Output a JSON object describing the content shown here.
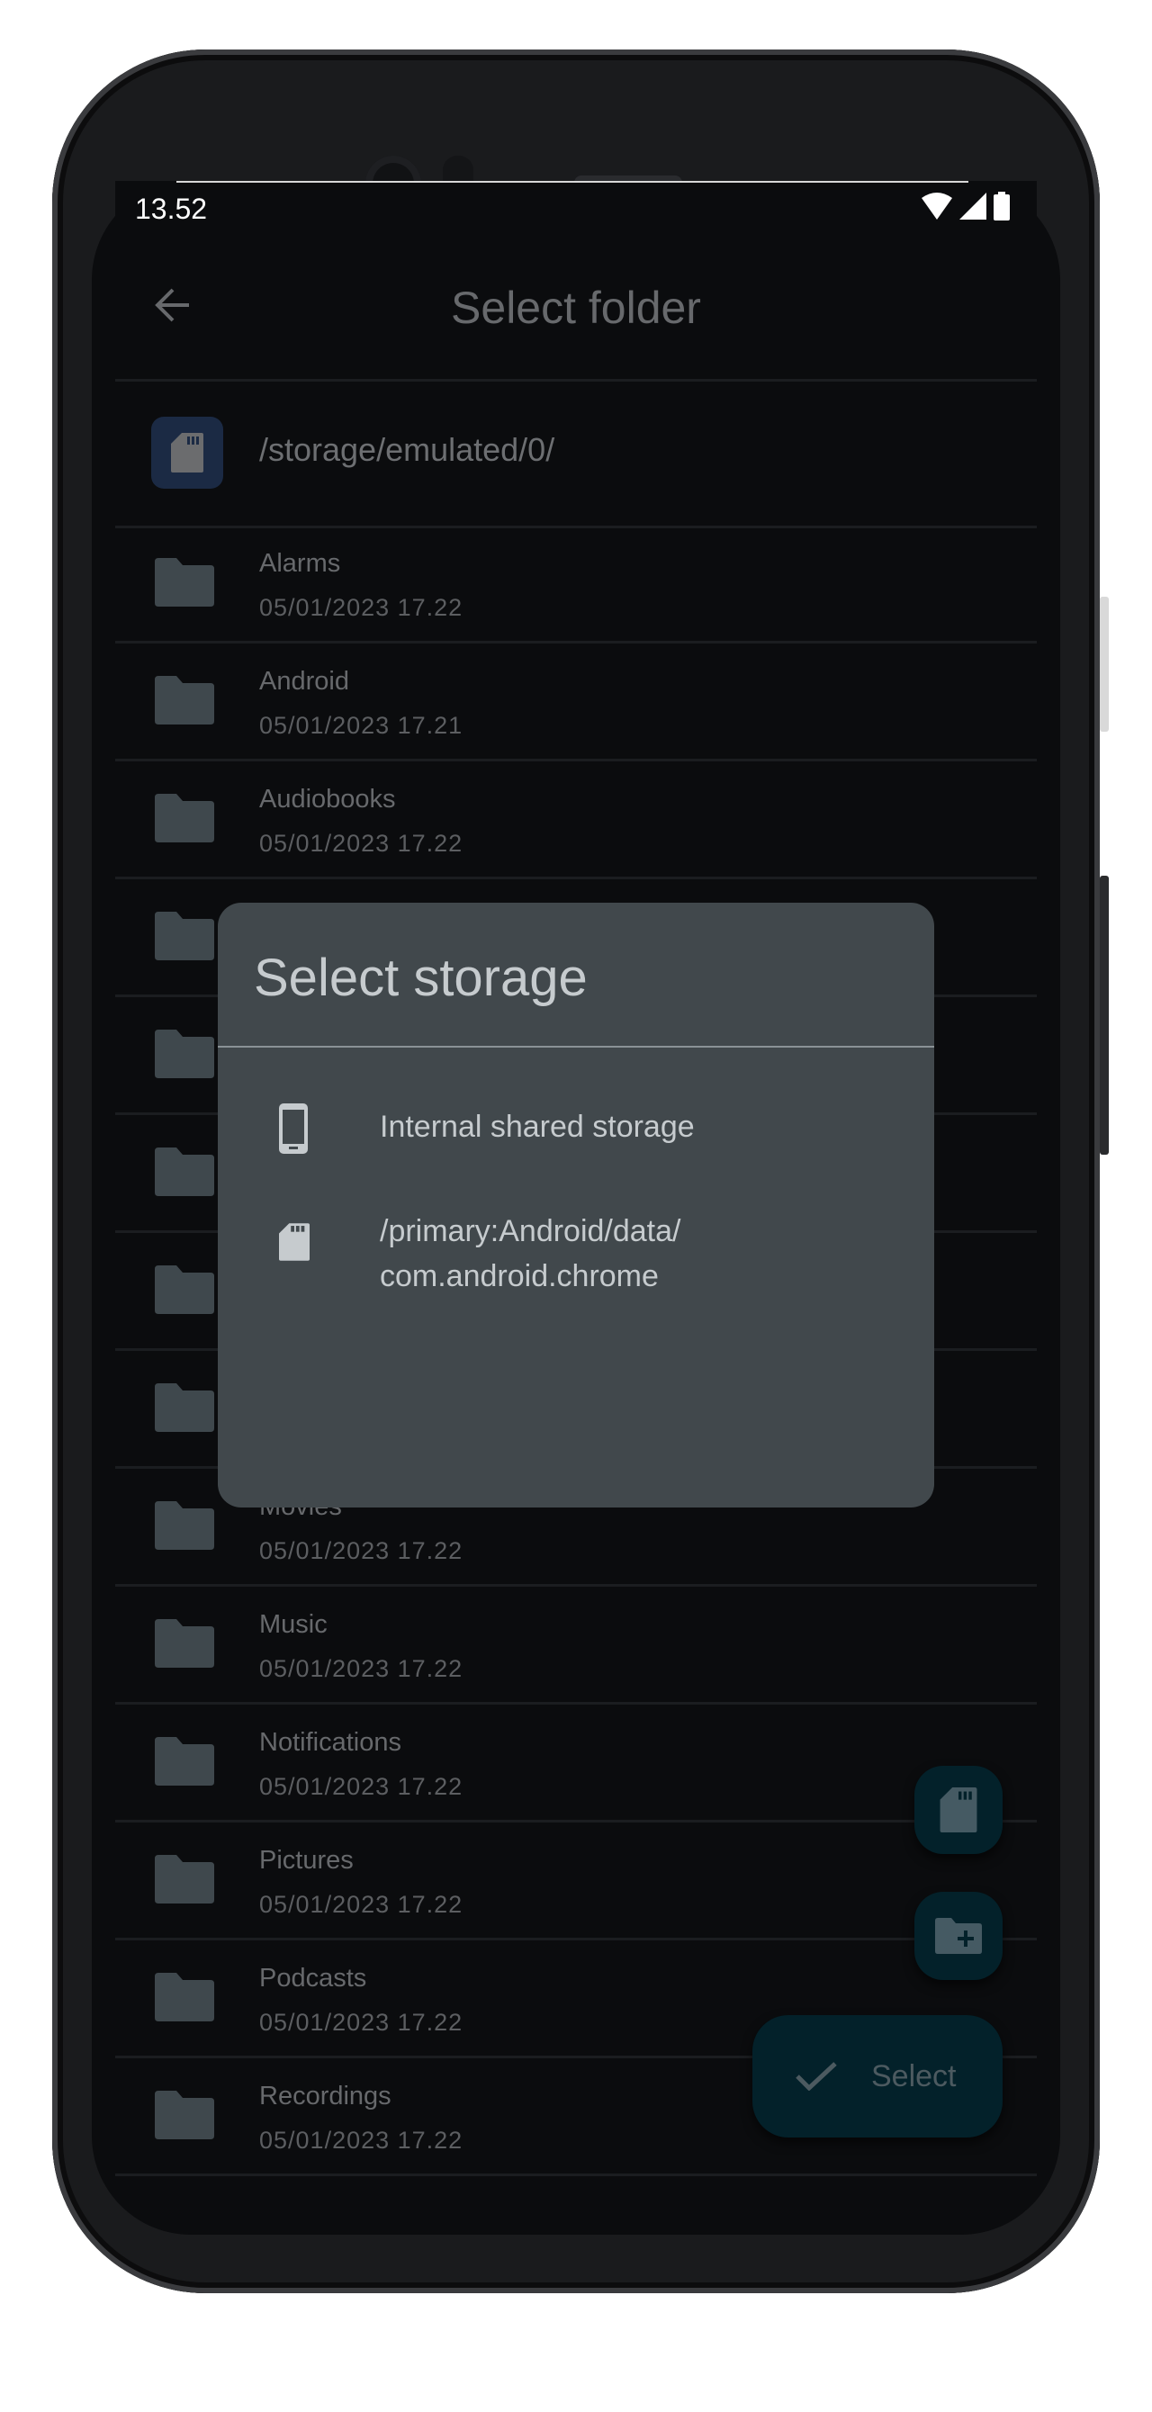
{
  "status_bar": {
    "time": "13.52",
    "icons": [
      "wifi-icon",
      "signal-icon",
      "battery-icon"
    ]
  },
  "app_bar": {
    "title": "Select folder",
    "back_icon": "arrow-back-icon"
  },
  "current_path": {
    "icon": "sd-card-icon",
    "path": "/storage/emulated/0/"
  },
  "folders": [
    {
      "name": "Alarms",
      "date": "05/01/2023 17.22"
    },
    {
      "name": "Android",
      "date": "05/01/2023 17.21"
    },
    {
      "name": "Audiobooks",
      "date": "05/01/2023 17.22"
    },
    {
      "name": "",
      "date": ""
    },
    {
      "name": "",
      "date": ""
    },
    {
      "name": "",
      "date": ""
    },
    {
      "name": "",
      "date": ""
    },
    {
      "name": "",
      "date": ""
    },
    {
      "name": "Movies",
      "date": "05/01/2023 17.22"
    },
    {
      "name": "Music",
      "date": "05/01/2023 17.22"
    },
    {
      "name": "Notifications",
      "date": "05/01/2023 17.22"
    },
    {
      "name": "Pictures",
      "date": "05/01/2023 17.22"
    },
    {
      "name": "Podcasts",
      "date": "05/01/2023 17.22"
    },
    {
      "name": "Recordings",
      "date": "05/01/2023 17.22"
    }
  ],
  "fabs": {
    "storage_icon": "sd-card-icon",
    "new_folder_icon": "create-new-folder-icon",
    "select_label": "Select",
    "select_icon": "check-icon"
  },
  "dialog": {
    "title": "Select storage",
    "items": [
      {
        "icon": "phone-icon",
        "label": "Internal shared storage"
      },
      {
        "icon": "sd-card-icon",
        "label_line1": "/primary:Android/data/",
        "label_line2": "com.android.chrome"
      }
    ]
  },
  "colors": {
    "background": "#0b0c0e",
    "dialog": "#41484c",
    "fab": "#03212a",
    "path_icon_bg": "#1b2a44"
  }
}
